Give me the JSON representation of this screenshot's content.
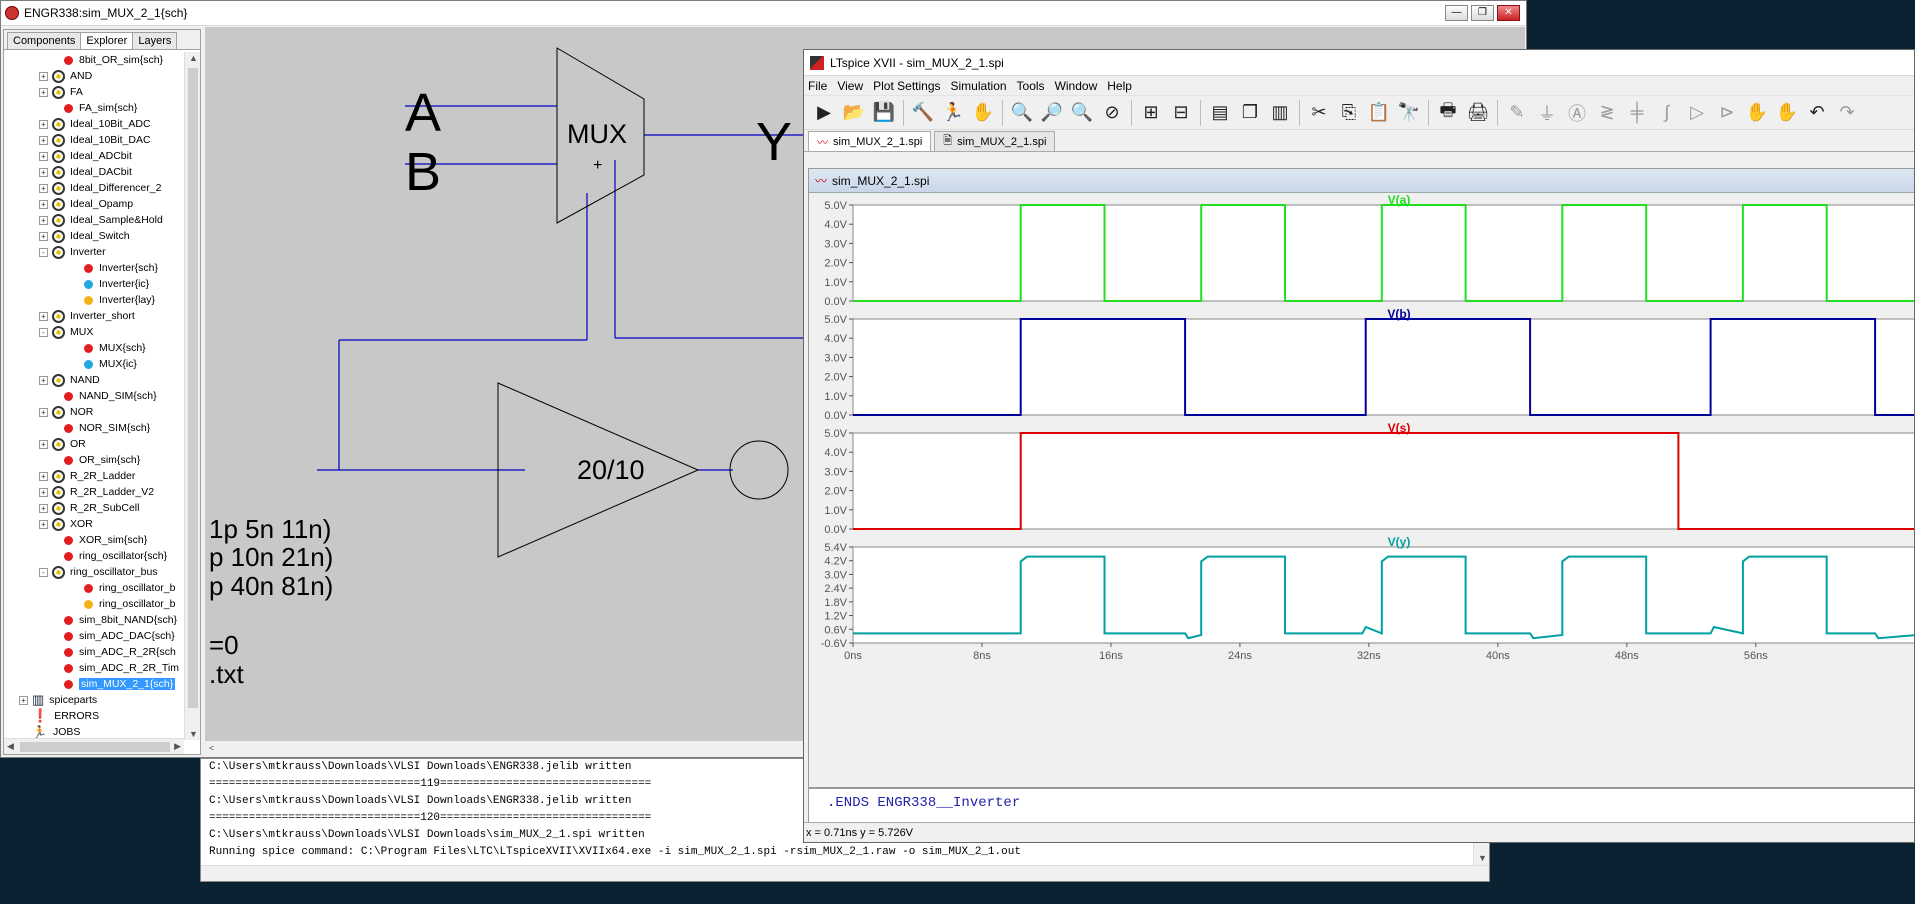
{
  "electric": {
    "title": "ENGR338:sim_MUX_2_1{sch}",
    "tabs": [
      "Components",
      "Explorer",
      "Layers"
    ],
    "tree": [
      {
        "indent": 60,
        "kind": "dot-red",
        "label": "8bit_OR_sim{sch}"
      },
      {
        "indent": 48,
        "kind": "lib",
        "expand": "+",
        "label": "AND"
      },
      {
        "indent": 48,
        "kind": "lib",
        "expand": "+",
        "label": "FA"
      },
      {
        "indent": 60,
        "kind": "dot-red",
        "label": "FA_sim{sch}"
      },
      {
        "indent": 48,
        "kind": "lib",
        "expand": "+",
        "label": "Ideal_10Bit_ADC"
      },
      {
        "indent": 48,
        "kind": "lib",
        "expand": "+",
        "label": "Ideal_10Bit_DAC"
      },
      {
        "indent": 48,
        "kind": "lib",
        "expand": "+",
        "label": "Ideal_ADCbit"
      },
      {
        "indent": 48,
        "kind": "lib",
        "expand": "+",
        "label": "Ideal_DACbit"
      },
      {
        "indent": 48,
        "kind": "lib",
        "expand": "+",
        "label": "Ideal_Differencer_2"
      },
      {
        "indent": 48,
        "kind": "lib",
        "expand": "+",
        "label": "Ideal_Opamp"
      },
      {
        "indent": 48,
        "kind": "lib",
        "expand": "+",
        "label": "Ideal_Sample&Hold"
      },
      {
        "indent": 48,
        "kind": "lib",
        "expand": "+",
        "label": "Ideal_Switch"
      },
      {
        "indent": 48,
        "kind": "lib",
        "expand": "-",
        "label": "Inverter"
      },
      {
        "indent": 80,
        "kind": "dot-red",
        "label": "Inverter{sch}"
      },
      {
        "indent": 80,
        "kind": "dot-cyan",
        "label": "Inverter{ic}"
      },
      {
        "indent": 80,
        "kind": "dot-orange",
        "label": "Inverter{lay}"
      },
      {
        "indent": 48,
        "kind": "lib",
        "expand": "+",
        "label": "Inverter_short"
      },
      {
        "indent": 48,
        "kind": "lib",
        "expand": "-",
        "label": "MUX"
      },
      {
        "indent": 80,
        "kind": "dot-red",
        "label": "MUX{sch}"
      },
      {
        "indent": 80,
        "kind": "dot-cyan",
        "label": "MUX{ic}"
      },
      {
        "indent": 48,
        "kind": "lib",
        "expand": "+",
        "label": "NAND"
      },
      {
        "indent": 60,
        "kind": "dot-red",
        "label": "NAND_SIM{sch}"
      },
      {
        "indent": 48,
        "kind": "lib",
        "expand": "+",
        "label": "NOR"
      },
      {
        "indent": 60,
        "kind": "dot-red",
        "label": "NOR_SIM{sch}"
      },
      {
        "indent": 48,
        "kind": "lib",
        "expand": "+",
        "label": "OR"
      },
      {
        "indent": 60,
        "kind": "dot-red",
        "label": "OR_sim{sch}"
      },
      {
        "indent": 48,
        "kind": "lib",
        "expand": "+",
        "label": "R_2R_Ladder"
      },
      {
        "indent": 48,
        "kind": "lib",
        "expand": "+",
        "label": "R_2R_Ladder_V2"
      },
      {
        "indent": 48,
        "kind": "lib",
        "expand": "+",
        "label": "R_2R_SubCell"
      },
      {
        "indent": 48,
        "kind": "lib",
        "expand": "+",
        "label": "XOR"
      },
      {
        "indent": 60,
        "kind": "dot-red",
        "label": "XOR_sim{sch}"
      },
      {
        "indent": 60,
        "kind": "dot-red",
        "label": "ring_oscillator{sch}"
      },
      {
        "indent": 48,
        "kind": "lib",
        "expand": "-",
        "label": "ring_oscillator_bus"
      },
      {
        "indent": 80,
        "kind": "dot-red",
        "label": "ring_oscillator_b"
      },
      {
        "indent": 80,
        "kind": "dot-orange",
        "label": "ring_oscillator_b"
      },
      {
        "indent": 60,
        "kind": "dot-red",
        "label": "sim_8bit_NAND{sch}"
      },
      {
        "indent": 60,
        "kind": "dot-red",
        "label": "sim_ADC_DAC{sch}"
      },
      {
        "indent": 60,
        "kind": "dot-red",
        "label": "sim_ADC_R_2R{sch"
      },
      {
        "indent": 60,
        "kind": "dot-red",
        "label": "sim_ADC_R_2R_Tim"
      },
      {
        "indent": 60,
        "kind": "dot-red",
        "label": "sim_MUX_2_1{sch}",
        "selected": true
      },
      {
        "indent": 28,
        "kind": "spiceparts",
        "expand": "+",
        "label": "spiceparts"
      },
      {
        "indent": 28,
        "kind": "errors",
        "label": "ERRORS"
      },
      {
        "indent": 28,
        "kind": "jobs",
        "label": "JOBS"
      }
    ],
    "schematic": {
      "label_a": "A",
      "label_b": "B",
      "label_y": "Y",
      "mux_label": "MUX",
      "mux_plus": "+",
      "inverter_label": "20/10",
      "text_lines": [
        "1p 5n 11n)",
        "p 10n 21n)",
        "p 40n 81n)",
        "=0",
        ".txt"
      ]
    },
    "console": [
      "C:\\Users\\mtkrauss\\Downloads\\VLSI Downloads\\ENGR338.jelib written",
      "================================119================================",
      "C:\\Users\\mtkrauss\\Downloads\\VLSI Downloads\\ENGR338.jelib written",
      "================================120================================",
      "C:\\Users\\mtkrauss\\Downloads\\VLSI Downloads\\sim_MUX_2_1.spi written",
      "Running spice command: C:\\Program Files\\LTC\\LTspiceXVII\\XVIIx64.exe -i sim_MUX_2_1.spi -rsim_MUX_2_1.raw -o sim_MUX_2_1.out"
    ]
  },
  "ltspice": {
    "title": "LTspice XVII - sim_MUX_2_1.spi",
    "menu": [
      "File",
      "View",
      "Plot Settings",
      "Simulation",
      "Tools",
      "Window",
      "Help"
    ],
    "toolbar": [
      {
        "name": "run-icon",
        "glyph": "▶"
      },
      {
        "name": "open-icon",
        "glyph": "📂"
      },
      {
        "name": "save-icon",
        "glyph": "💾"
      },
      {
        "sep": true
      },
      {
        "name": "control-panel-icon",
        "glyph": "🔨"
      },
      {
        "name": "run-stop-icon",
        "glyph": "🏃"
      },
      {
        "name": "pan-icon",
        "glyph": "✋",
        "dim": true
      },
      {
        "sep": true
      },
      {
        "name": "zoom-in-icon",
        "glyph": "🔍"
      },
      {
        "name": "zoom-area-icon",
        "glyph": "🔎"
      },
      {
        "name": "zoom-out-icon",
        "glyph": "🔍"
      },
      {
        "name": "zoom-cancel-icon",
        "glyph": "⊘"
      },
      {
        "sep": true
      },
      {
        "name": "autorange-icon",
        "glyph": "⊞"
      },
      {
        "name": "fit-icon",
        "glyph": "⊟"
      },
      {
        "sep": true
      },
      {
        "name": "tile-horizontal-icon",
        "glyph": "▤"
      },
      {
        "name": "cascade-icon",
        "glyph": "❐"
      },
      {
        "name": "tile-vertical-icon",
        "glyph": "▥"
      },
      {
        "sep": true
      },
      {
        "name": "cut-icon",
        "glyph": "✂"
      },
      {
        "name": "copy-icon",
        "glyph": "⎘"
      },
      {
        "name": "paste-icon",
        "glyph": "📋"
      },
      {
        "name": "find-icon",
        "glyph": "🔭"
      },
      {
        "sep": true
      },
      {
        "name": "print-icon",
        "glyph": "🖶"
      },
      {
        "name": "print-setup-icon",
        "glyph": "🖨"
      },
      {
        "sep": true
      },
      {
        "name": "wire-icon",
        "glyph": "✎",
        "dim": true
      },
      {
        "name": "ground-icon",
        "glyph": "⏚",
        "dim": true
      },
      {
        "name": "label-icon",
        "glyph": "Ⓐ",
        "dim": true
      },
      {
        "name": "resistor-icon",
        "glyph": "≷",
        "dim": true
      },
      {
        "name": "capacitor-icon",
        "glyph": "╪",
        "dim": true
      },
      {
        "name": "inductor-icon",
        "glyph": "∫",
        "dim": true
      },
      {
        "name": "diode-icon",
        "glyph": "▷",
        "dim": true
      },
      {
        "name": "component-icon",
        "glyph": "⊳",
        "dim": true
      },
      {
        "name": "move-icon",
        "glyph": "✋",
        "dim": true
      },
      {
        "name": "drag-icon",
        "glyph": "✋",
        "dim": true
      },
      {
        "name": "undo-icon",
        "glyph": "↶"
      },
      {
        "name": "redo-icon",
        "glyph": "↷",
        "dim": true
      }
    ],
    "doc_tabs": [
      "sim_MUX_2_1.spi",
      "sim_MUX_2_1.spi"
    ],
    "plot_title": "sim_MUX_2_1.spi",
    "netlist_line": ".ENDS ENGR338__Inverter",
    "status_text": "x = 0.71ns   y = 5.726V"
  },
  "chart_data": [
    {
      "type": "line",
      "title": "V(a)",
      "color": "#22dd22",
      "ylim": [
        0,
        5
      ],
      "yticks": [
        "5.0V",
        "4.0V",
        "3.0V",
        "2.0V",
        "1.0V",
        "0.0V"
      ],
      "series": [
        {
          "name": "V(a)",
          "x": [
            0,
            10.4,
            10.4,
            15.6,
            15.6,
            21.6,
            21.6,
            26.8,
            26.8,
            32.8,
            32.8,
            38.0,
            38.0,
            44.0,
            44.0,
            49.2,
            49.2,
            55.2,
            55.2,
            60.4,
            60.4,
            66
          ],
          "y": [
            0,
            0,
            5,
            5,
            0,
            0,
            5,
            5,
            0,
            0,
            5,
            5,
            0,
            0,
            5,
            5,
            0,
            0,
            5,
            5,
            0,
            0
          ]
        }
      ]
    },
    {
      "type": "line",
      "title": "V(b)",
      "color": "#00009a",
      "ylim": [
        0,
        5
      ],
      "yticks": [
        "5.0V",
        "4.0V",
        "3.0V",
        "2.0V",
        "1.0V",
        "0.0V"
      ],
      "series": [
        {
          "name": "V(b)",
          "x": [
            0,
            10.4,
            10.4,
            20.6,
            20.6,
            31.8,
            31.8,
            42.0,
            42.0,
            53.2,
            53.2,
            63.4,
            63.4,
            66
          ],
          "y": [
            0,
            0,
            5,
            5,
            0,
            0,
            5,
            5,
            0,
            0,
            5,
            5,
            0,
            0
          ]
        }
      ]
    },
    {
      "type": "line",
      "title": "V(s)",
      "color": "#dd0000",
      "ylim": [
        0,
        5
      ],
      "yticks": [
        "5.0V",
        "4.0V",
        "3.0V",
        "2.0V",
        "1.0V",
        "0.0V"
      ],
      "series": [
        {
          "name": "V(s)",
          "x": [
            0,
            10.4,
            10.4,
            51.2,
            51.2,
            66
          ],
          "y": [
            0,
            0,
            5,
            5,
            0,
            0
          ]
        }
      ]
    },
    {
      "type": "line",
      "title": "V(y)",
      "color": "#00a0a0",
      "ylim": [
        -0.6,
        5.4
      ],
      "yticks": [
        "5.4V",
        "4.2V",
        "3.0V",
        "2.4V",
        "1.8V",
        "1.2V",
        "0.6V",
        "-0.6V"
      ],
      "xticks": [
        "0ns",
        "8ns",
        "16ns",
        "24ns",
        "32ns",
        "40ns",
        "48ns",
        "56ns"
      ],
      "series": [
        {
          "name": "V(y)",
          "x": [
            0,
            10.4,
            10.4,
            10.8,
            15.2,
            15.6,
            15.6,
            20.6,
            20.8,
            21.6,
            21.6,
            22.0,
            26.4,
            26.8,
            26.8,
            31.6,
            31.8,
            32.8,
            32.8,
            33.2,
            37.6,
            38.0,
            38.0,
            42.0,
            42.2,
            44.0,
            44.0,
            44.4,
            48.8,
            49.2,
            49.2,
            53.2,
            53.4,
            55.2,
            55.2,
            55.6,
            60.0,
            60.4,
            60.4,
            63.4,
            63.6,
            66
          ],
          "y": [
            0.0,
            0.0,
            4.5,
            4.8,
            4.8,
            4.8,
            0.0,
            0.0,
            -0.3,
            -0.1,
            4.5,
            4.8,
            4.8,
            4.8,
            0.0,
            0.0,
            0.4,
            0.0,
            4.5,
            4.8,
            4.8,
            4.8,
            0.0,
            0.0,
            -0.3,
            -0.1,
            4.5,
            4.8,
            4.8,
            4.8,
            0.0,
            0.0,
            0.4,
            0.0,
            4.5,
            4.8,
            4.8,
            4.8,
            0.0,
            0.0,
            -0.3,
            -0.1
          ]
        }
      ]
    }
  ],
  "colors": {
    "wire": "#0000c0",
    "schematic_bg": "#c8c8c8",
    "selection": "#3399ff"
  }
}
